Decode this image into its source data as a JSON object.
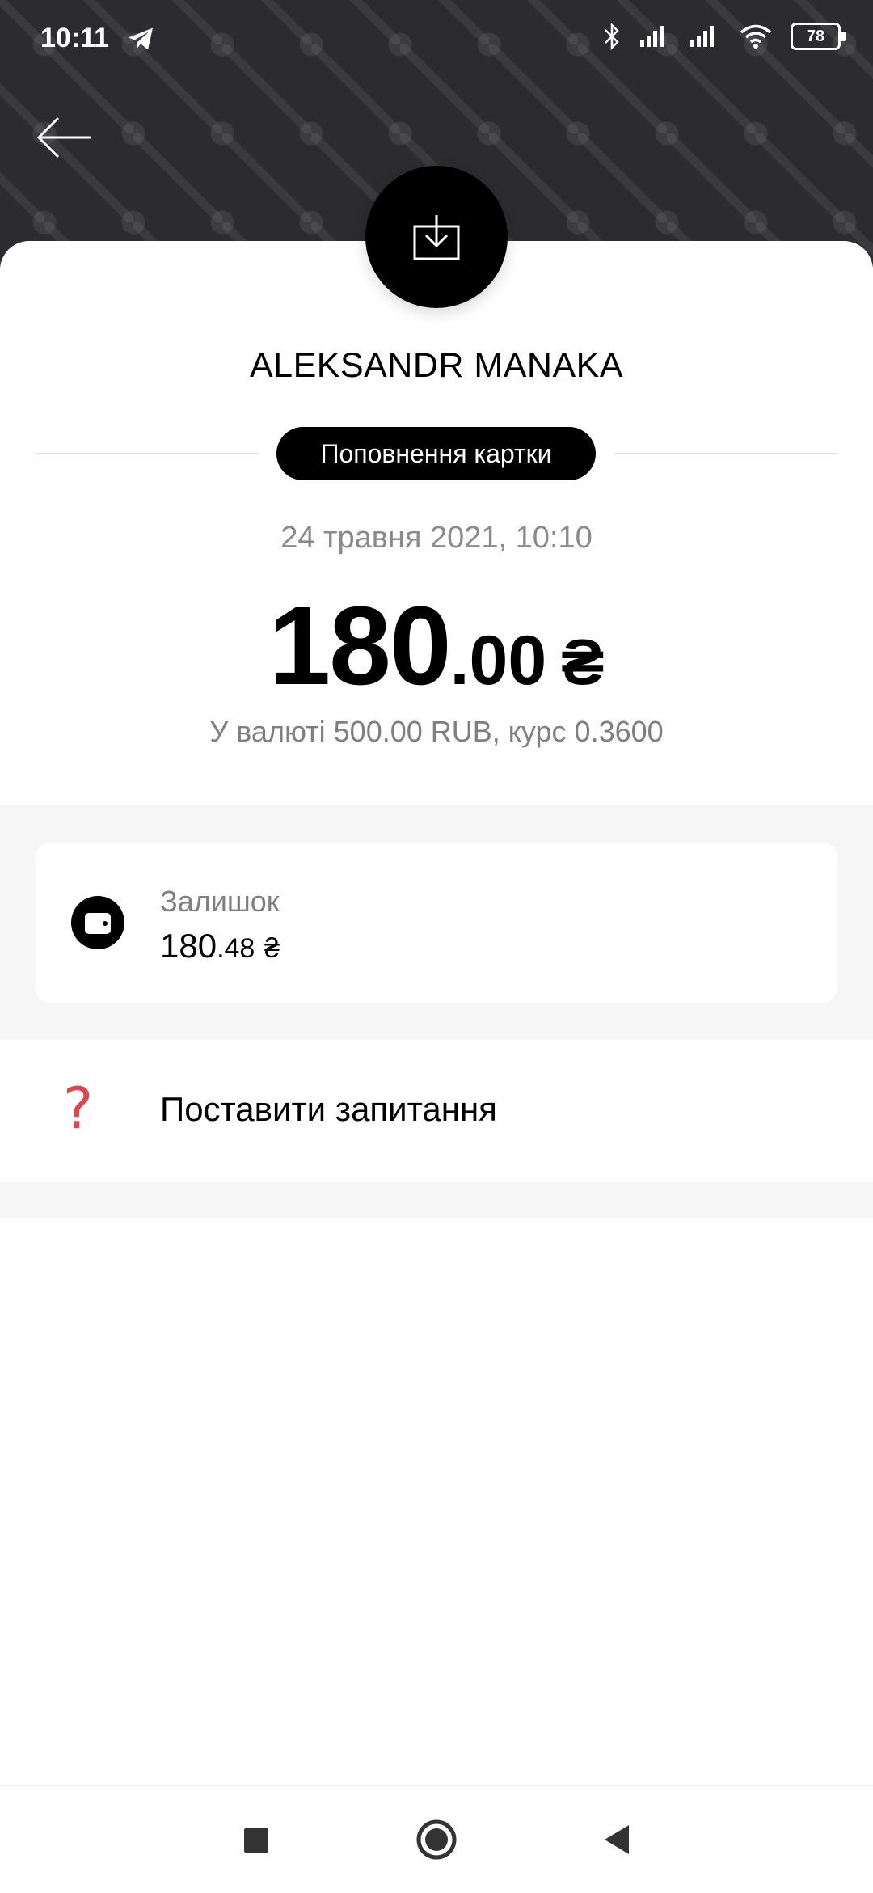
{
  "status_bar": {
    "time": "10:11",
    "battery": "78"
  },
  "transaction": {
    "name": "ALEKSANDR MANAKA",
    "type": "Поповнення картки",
    "date": "24 травня 2021, 10:10",
    "amount_int": "180",
    "amount_frac": ".00",
    "currency": "₴",
    "conversion": "У валюті 500.00 RUB, курс 0.3600"
  },
  "balance": {
    "label": "Залишок",
    "int": "180",
    "frac": ".48",
    "currency": "₴"
  },
  "actions": {
    "ask_question": "Поставити запитання"
  },
  "colors": {
    "header_bg": "#2c2c30",
    "accent_question": "#e3444d"
  },
  "icons": {
    "header_action": "download-icon",
    "wallet": "wallet-icon",
    "question": "question-icon"
  }
}
